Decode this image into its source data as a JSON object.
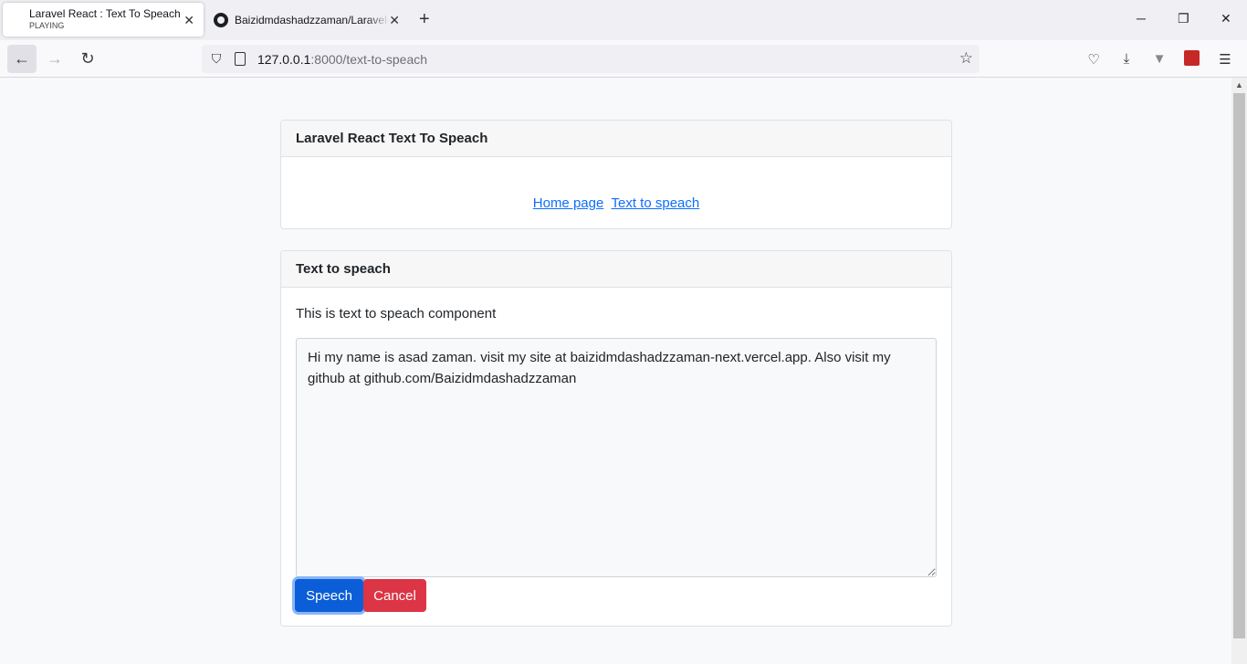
{
  "browser": {
    "tabs": [
      {
        "title": "Laravel React : Text To Speach",
        "subtitle": "PLAYING",
        "active": true
      },
      {
        "title": "Baizidmdashadzzaman/Laravel-",
        "active": false
      }
    ],
    "url_host": "127.0.0.1",
    "url_rest": ":8000/text-to-speach"
  },
  "header_card": {
    "title": "Laravel React Text To Speach",
    "links": [
      "Home page",
      "Text to speach"
    ]
  },
  "tts_card": {
    "title": "Text to speach",
    "description": "This is text to speach component",
    "textarea_value": "Hi my name is asad zaman. visit my site at baizidmdashadzzaman-next.vercel.app. Also visit my github at github.com/Baizidmdashadzzaman",
    "speech_button": "Speech",
    "cancel_button": "Cancel"
  },
  "icons": {
    "tab_close": "close-icon",
    "new_tab": "plus-icon",
    "back": "arrow-left-icon",
    "forward": "arrow-right-icon",
    "reload": "reload-icon",
    "tracking": "shield-icon",
    "bookmark": "star-icon",
    "pocket": "pocket-icon",
    "downloads": "download-icon",
    "menu": "hamburger-icon"
  },
  "colors": {
    "link": "#0d6efd",
    "primary": "#0b5ed7",
    "danger": "#dc3545"
  }
}
